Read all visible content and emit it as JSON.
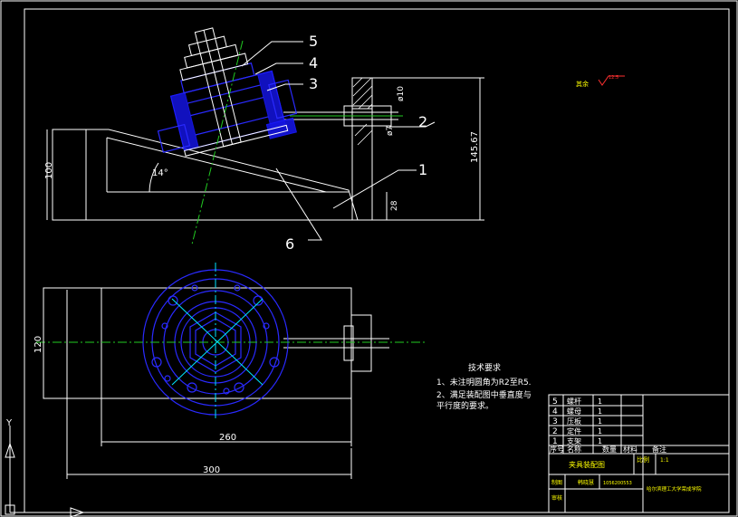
{
  "part_numbers": [
    "5",
    "4",
    "3",
    "2",
    "1",
    "6"
  ],
  "dimensions": {
    "d10": "ø10",
    "d7": "ø7",
    "h145": "145.67",
    "h100": "100",
    "angle": "14°",
    "h28": "28",
    "w120": "120",
    "w260": "260",
    "w300": "300"
  },
  "surface_note": {
    "label": "其余",
    "value": "12.5"
  },
  "tech_requirements": {
    "title": "技术要求",
    "line1": "1、未注明圆角为R2至R5.",
    "line2": "2、满足装配图中垂直度与",
    "line3": "平行度的要求。"
  },
  "bom": {
    "rows": [
      {
        "no": "5",
        "name": "螺杆",
        "qty": "1"
      },
      {
        "no": "4",
        "name": "螺母",
        "qty": "1"
      },
      {
        "no": "3",
        "name": "压板",
        "qty": "1"
      },
      {
        "no": "2",
        "name": "定件",
        "qty": "1"
      },
      {
        "no": "1",
        "name": "支架",
        "qty": "1"
      }
    ],
    "header": {
      "no": "序号",
      "name": "名称",
      "qty": "数量",
      "material": "材料",
      "remark": "备注"
    }
  },
  "title_block": {
    "drawing_name": "夹具装配图",
    "scale_label": "比例",
    "scale_value": "1:1",
    "designer_label": "制图",
    "designer": "韩晓慧",
    "student_id": "1056200553",
    "reviewer_label": "审核",
    "school": "哈尔滨理工大学荣成学院"
  },
  "ucs": {
    "y": "Y"
  }
}
